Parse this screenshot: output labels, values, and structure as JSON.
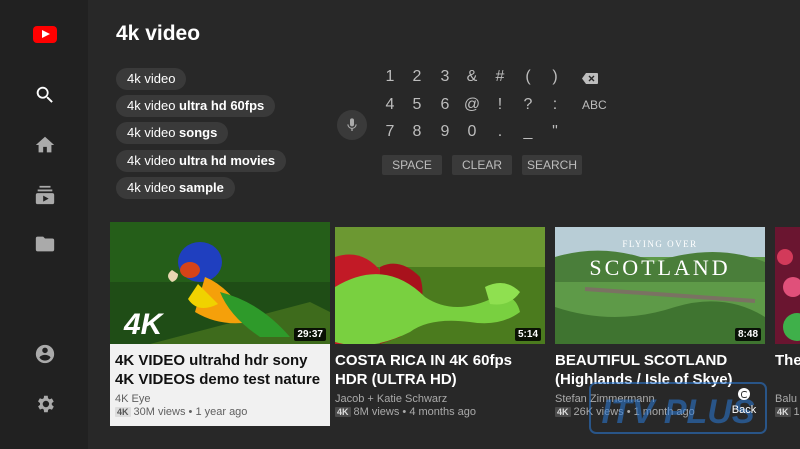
{
  "sidebar": {
    "logo": "youtube-logo",
    "items": [
      {
        "name": "search",
        "icon": "search-icon",
        "active": true
      },
      {
        "name": "home",
        "icon": "home-icon"
      },
      {
        "name": "subscriptions",
        "icon": "subscriptions-icon"
      },
      {
        "name": "library",
        "icon": "folder-icon"
      },
      {
        "name": "account",
        "icon": "account-icon"
      },
      {
        "name": "settings",
        "icon": "gear-icon"
      }
    ]
  },
  "search": {
    "query": "4k video"
  },
  "suggestions": [
    {
      "base": "4k video",
      "bold": ""
    },
    {
      "base": "4k video ",
      "bold": "ultra hd 60fps"
    },
    {
      "base": "4k video ",
      "bold": "songs"
    },
    {
      "base": "4k video ",
      "bold": "ultra hd movies"
    },
    {
      "base": "4k video ",
      "bold": "sample"
    }
  ],
  "keyboard": {
    "rows": [
      [
        "1",
        "2",
        "3",
        "&",
        "#",
        "(",
        ")"
      ],
      [
        "4",
        "5",
        "6",
        "@",
        "!",
        "?",
        ":"
      ],
      [
        "7",
        "8",
        "9",
        "0",
        ".",
        "_",
        "\""
      ]
    ],
    "abc_label": "ABC",
    "space_label": "SPACE",
    "clear_label": "CLEAR",
    "search_label": "SEARCH"
  },
  "results": [
    {
      "title": "4K VIDEO ultrahd hdr sony 4K VIDEOS demo test nature",
      "channel": "4K Eye",
      "badge": "4K",
      "meta": "30M views • 1 year ago",
      "duration": "29:37",
      "thumb_text": "4K"
    },
    {
      "title": "COSTA RICA IN 4K 60fps HDR (ULTRA HD)",
      "channel": "Jacob + Katie Schwarz",
      "badge": "4K",
      "meta": "8M views • 4 months ago",
      "duration": "5:14"
    },
    {
      "title": "BEAUTIFUL SCOTLAND (Highlands / Isle of Skye)",
      "channel": "Stefan Zimmermann",
      "badge": "4K",
      "meta": "26K views • 1 month ago",
      "duration": "8:48",
      "thumb_caption_small": "FLYING OVER",
      "thumb_caption": "SCOTLAND"
    },
    {
      "title": "The Rela",
      "channel": "Balu -",
      "badge": "4K",
      "meta": "1"
    }
  ],
  "back_label": "Back",
  "watermark": "ITV PLUS"
}
